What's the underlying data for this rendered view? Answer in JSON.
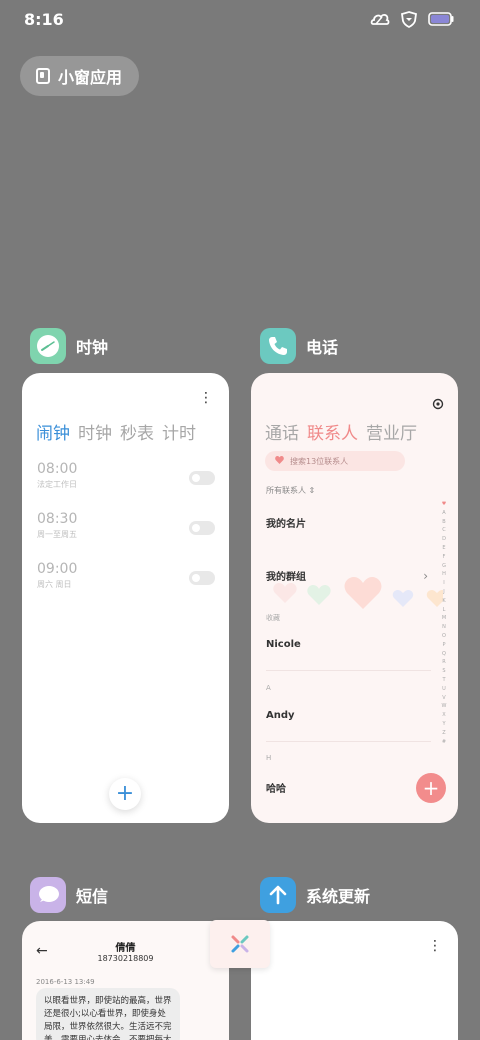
{
  "status_bar": {
    "time": "8:16",
    "icons": [
      "cloud-icon",
      "shield-icon",
      "battery-icon"
    ]
  },
  "small_window": {
    "label": "小窗应用"
  },
  "apps": {
    "clock": {
      "name": "时钟",
      "tabs": [
        "闹钟",
        "时钟",
        "秒表",
        "计时"
      ],
      "active_tab": 0,
      "alarms": [
        {
          "time": "08:00",
          "repeat": "法定工作日"
        },
        {
          "time": "08:30",
          "repeat": "周一至周五"
        },
        {
          "time": "09:00",
          "repeat": "周六 周日"
        }
      ],
      "add_label": "+"
    },
    "phone": {
      "name": "电话",
      "tabs": [
        "通话",
        "联系人",
        "营业厅"
      ],
      "active_tab": 1,
      "search_placeholder": "搜索13位联系人",
      "all_contacts": "所有联系人",
      "my_card": "我的名片",
      "my_groups": "我的群组",
      "favorites_label": "收藏",
      "contacts": [
        {
          "section": "",
          "name": "Nicole"
        },
        {
          "section": "A",
          "name": "Andy"
        },
        {
          "section": "H",
          "name": "哈哈"
        }
      ],
      "alpha_index": [
        "A",
        "B",
        "C",
        "D",
        "E",
        "F",
        "G",
        "H",
        "I",
        "J",
        "K",
        "L",
        "M",
        "N",
        "O",
        "P",
        "Q",
        "R",
        "S",
        "T",
        "U",
        "V",
        "W",
        "X",
        "Y",
        "Z",
        "#"
      ],
      "add_label": "+",
      "accent_color": "#f08a8a"
    },
    "messages": {
      "name": "短信",
      "contact_name": "倩倩",
      "contact_number": "18730218809",
      "date": "2016-6-13 13:49",
      "message": "以眼看世界，即使站的最高，世界还是很小;以心看世界，即使身处局限，世界依然很大。生活远不完美，需要用心去体会，不要把每大小事。"
    },
    "update": {
      "name": "系统更新"
    }
  }
}
